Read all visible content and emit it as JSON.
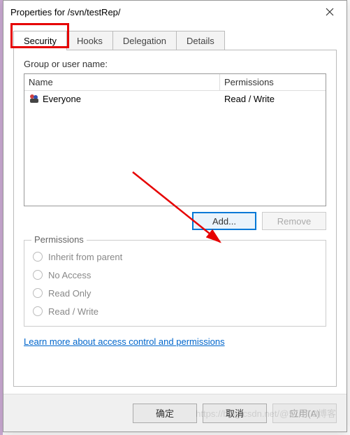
{
  "window": {
    "title": "Properties for /svn/testRep/"
  },
  "tabs": {
    "security": "Security",
    "hooks": "Hooks",
    "delegation": "Delegation",
    "details": "Details"
  },
  "group_label": "Group or user name:",
  "columns": {
    "name": "Name",
    "permissions": "Permissions"
  },
  "rows": [
    {
      "name": "Everyone",
      "permissions": "Read / Write"
    }
  ],
  "buttons": {
    "add": "Add...",
    "remove": "Remove",
    "ok": "确定",
    "cancel": "取消",
    "apply": "应用(A)"
  },
  "permissions_box": {
    "legend": "Permissions",
    "options": {
      "inherit": "Inherit from parent",
      "no_access": "No Access",
      "read_only": "Read Only",
      "read_write": "Read / Write"
    }
  },
  "link": {
    "text": "Learn more about access control and permissions"
  },
  "watermark": "https://blog.csdn.net/@51CTO博客"
}
